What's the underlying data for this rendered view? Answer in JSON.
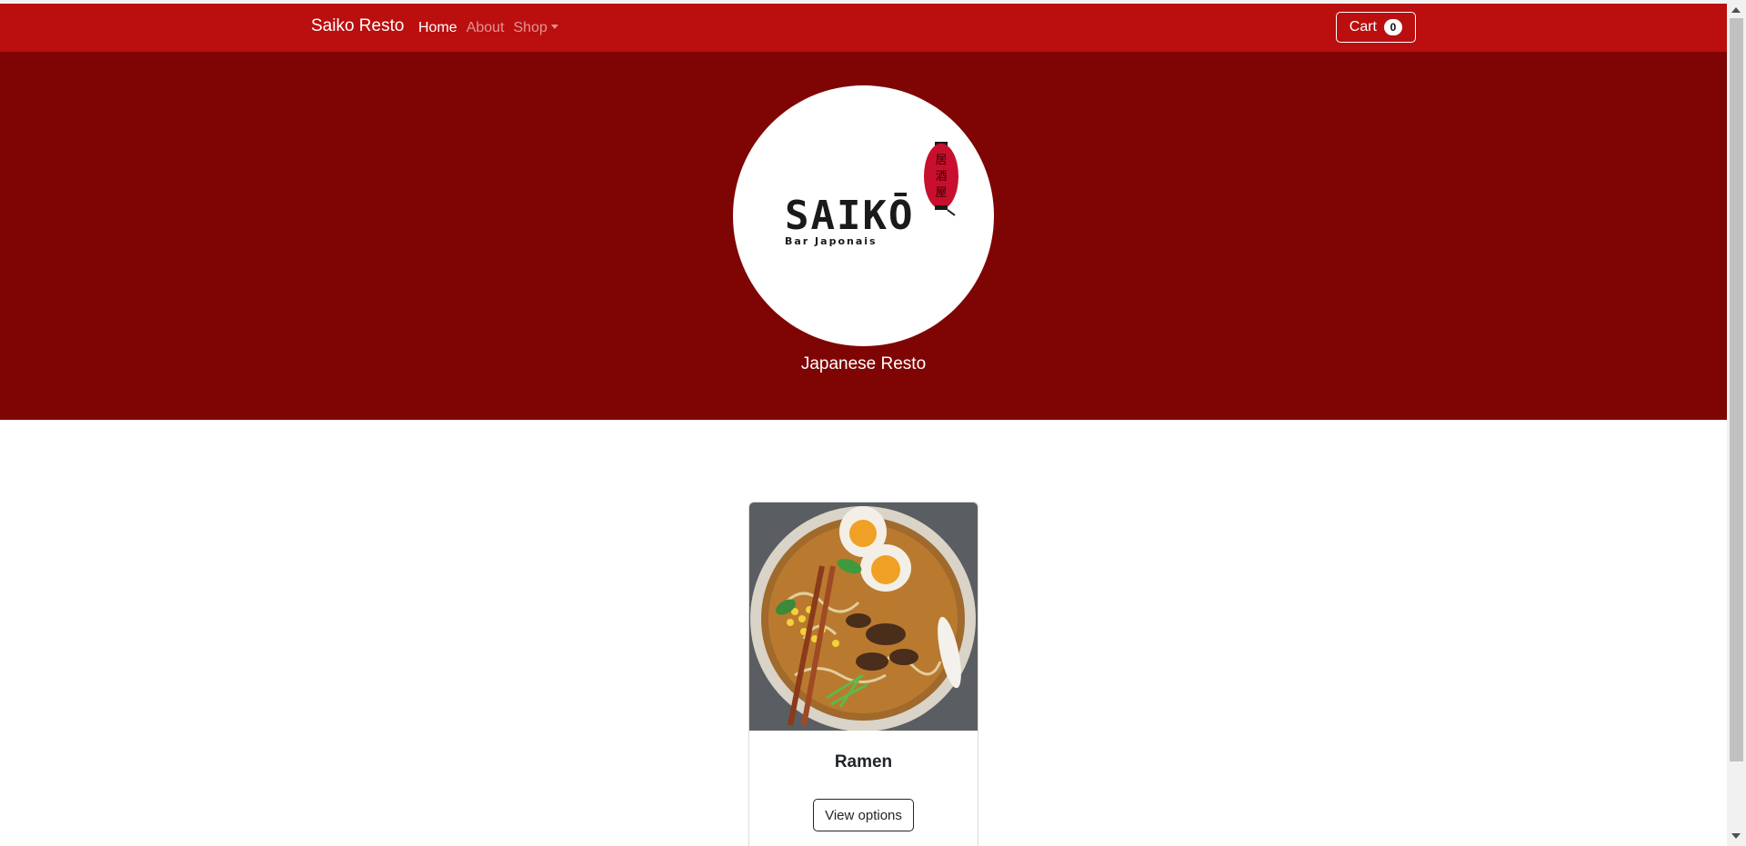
{
  "navbar": {
    "brand": "Saiko Resto",
    "links": [
      {
        "label": "Home",
        "active": true
      },
      {
        "label": "About",
        "active": false
      },
      {
        "label": "Shop",
        "active": false,
        "dropdown": true
      }
    ],
    "cart": {
      "label": "Cart",
      "count": "0"
    }
  },
  "hero": {
    "logo": {
      "wordmark": "SAIKŌ",
      "subtitle": "Bar Japonais",
      "lantern_text": "居酒屋"
    },
    "caption": "Japanese Resto"
  },
  "products": [
    {
      "name": "Ramen",
      "button": "View options",
      "image": "ramen-bowl-photo"
    }
  ],
  "colors": {
    "navbar": "#bb0e0e",
    "hero": "#7f0505",
    "lantern": "#c8102e"
  }
}
